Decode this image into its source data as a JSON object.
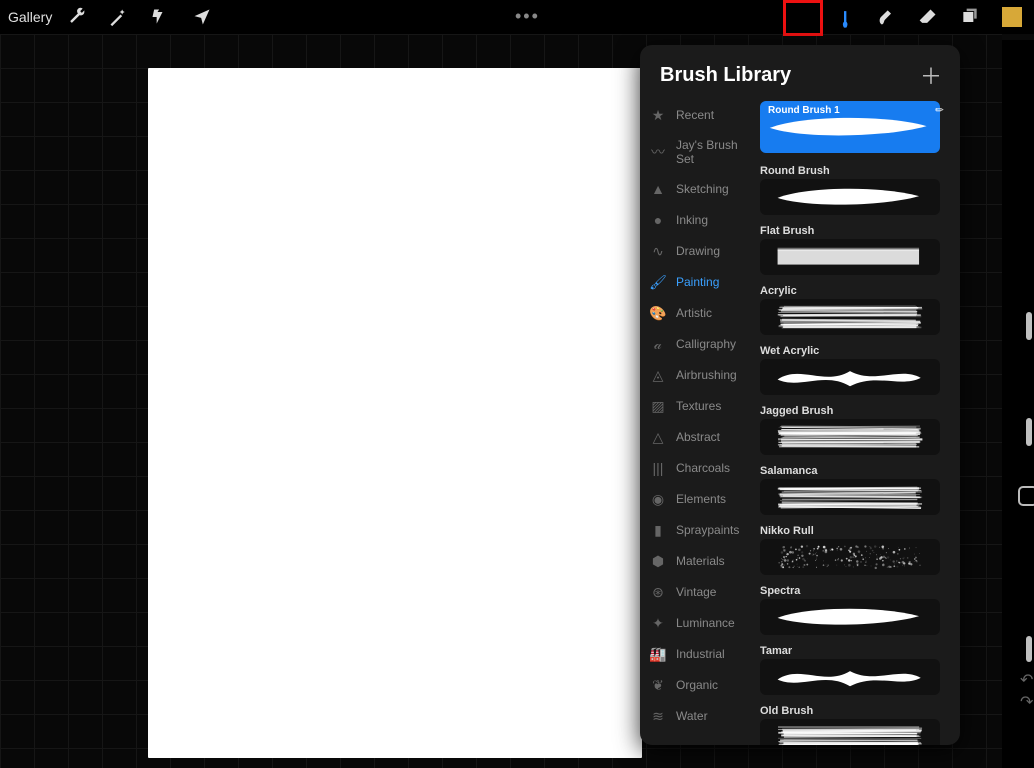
{
  "topbar": {
    "gallery": "Gallery"
  },
  "panel": {
    "title": "Brush Library"
  },
  "categories": [
    {
      "icon": "★",
      "label": "Recent"
    },
    {
      "icon": "〰",
      "label": "Jay's Brush Set"
    },
    {
      "icon": "▲",
      "label": "Sketching"
    },
    {
      "icon": "●",
      "label": "Inking"
    },
    {
      "icon": "∿",
      "label": "Drawing"
    },
    {
      "icon": "🖌",
      "label": "Painting",
      "active": true
    },
    {
      "icon": "🎨",
      "label": "Artistic"
    },
    {
      "icon": "𝒶",
      "label": "Calligraphy"
    },
    {
      "icon": "◬",
      "label": "Airbrushing"
    },
    {
      "icon": "▨",
      "label": "Textures"
    },
    {
      "icon": "△",
      "label": "Abstract"
    },
    {
      "icon": "|||",
      "label": "Charcoals"
    },
    {
      "icon": "◉",
      "label": "Elements"
    },
    {
      "icon": "▮",
      "label": "Spraypaints"
    },
    {
      "icon": "⬢",
      "label": "Materials"
    },
    {
      "icon": "⊛",
      "label": "Vintage"
    },
    {
      "icon": "✦",
      "label": "Luminance"
    },
    {
      "icon": "🏭",
      "label": "Industrial"
    },
    {
      "icon": "❦",
      "label": "Organic"
    },
    {
      "icon": "≋",
      "label": "Water"
    }
  ],
  "brushes": [
    {
      "name": "Round Brush 1",
      "selected": true
    },
    {
      "name": "Round Brush"
    },
    {
      "name": "Flat Brush"
    },
    {
      "name": "Acrylic"
    },
    {
      "name": "Wet Acrylic"
    },
    {
      "name": "Jagged Brush"
    },
    {
      "name": "Salamanca"
    },
    {
      "name": "Nikko Rull"
    },
    {
      "name": "Spectra"
    },
    {
      "name": "Tamar"
    },
    {
      "name": "Old Brush"
    }
  ]
}
